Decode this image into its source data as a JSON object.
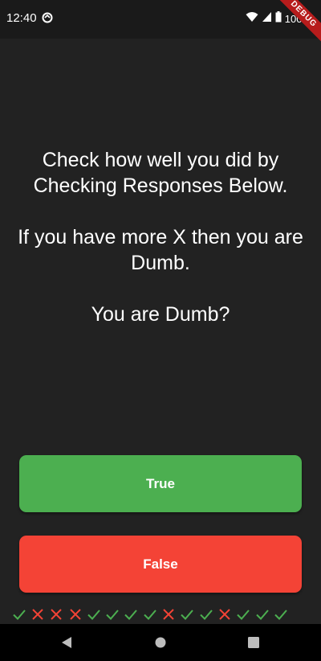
{
  "status_bar": {
    "time": "12:40",
    "battery": "100%",
    "debug_banner": "DEBUG"
  },
  "question": {
    "line1": "Check how well you did by Checking Responses Below.",
    "line2": "If you have more X then you are Dumb.",
    "line3": "You are Dumb?"
  },
  "buttons": {
    "true_label": "True",
    "false_label": "False"
  },
  "colors": {
    "background": "#222222",
    "true_button": "#4caf50",
    "false_button": "#f44336",
    "check": "#4caf50",
    "cross": "#f44336"
  },
  "score_keeper": [
    "check",
    "cross",
    "cross",
    "cross",
    "check",
    "check",
    "check",
    "check",
    "cross",
    "check",
    "check",
    "cross",
    "check",
    "check",
    "check"
  ]
}
